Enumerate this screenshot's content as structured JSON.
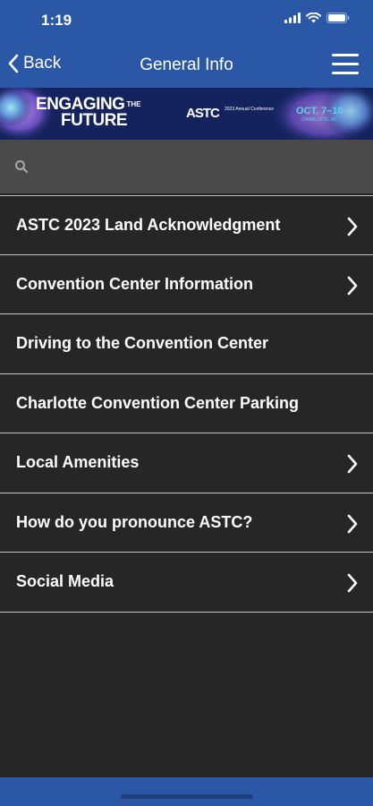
{
  "status_bar": {
    "time": "1:19"
  },
  "navbar": {
    "back_label": "Back",
    "title": "General Info"
  },
  "banner": {
    "line1": "ENGAGING",
    "the": "THE",
    "line2": "FUTURE",
    "org": "ASTC",
    "conference": "2023 Annual Conference",
    "dates": "OCT. 7–10",
    "city": "CHARLOTTE, NC"
  },
  "search": {
    "placeholder": ""
  },
  "list": {
    "items": [
      {
        "label": "ASTC 2023 Land Acknowledgment",
        "has_chevron": true
      },
      {
        "label": "Convention Center Information",
        "has_chevron": true
      },
      {
        "label": "Driving to the Convention Center",
        "has_chevron": false
      },
      {
        "label": "Charlotte Convention Center Parking",
        "has_chevron": false
      },
      {
        "label": "Local Amenities",
        "has_chevron": true
      },
      {
        "label": "How do you pronounce ASTC?",
        "has_chevron": true
      },
      {
        "label": "Social Media",
        "has_chevron": true
      }
    ]
  },
  "colors": {
    "header_bg": "#2b58a6",
    "list_bg": "#262626",
    "search_bg": "#4a4a4a",
    "divider": "#c8c8c8"
  },
  "icons": {
    "back": "chevron-left-icon",
    "menu": "hamburger-menu-icon",
    "search": "search-icon",
    "item": "chevron-right-icon"
  }
}
